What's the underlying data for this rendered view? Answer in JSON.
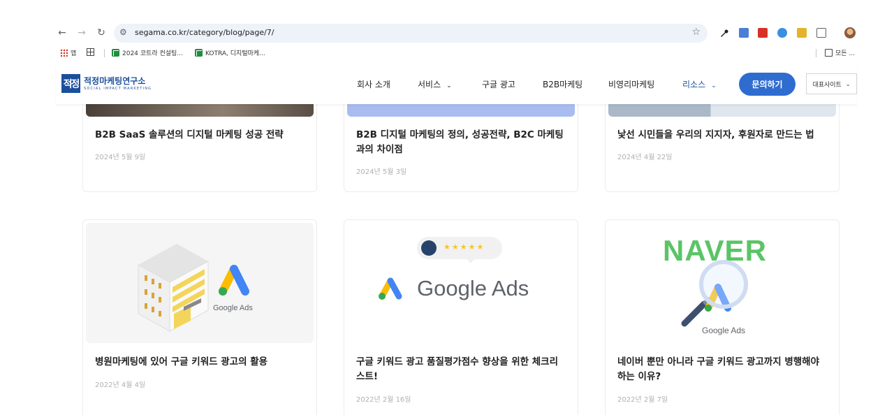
{
  "browser": {
    "url": "segama.co.kr/category/blog/page/7/",
    "bookmarks": [
      {
        "label": "앱"
      },
      {
        "label": "2024 코트라 컨설팅..."
      },
      {
        "label": "KOTRA, 디지털마케..."
      },
      {
        "label": "모든 ..."
      }
    ]
  },
  "site": {
    "logo_name": "적정마케팅연구소",
    "logo_sub": "SOCIAL IMPACT MARKETING",
    "logo_mark": "적정",
    "menu": [
      {
        "label": "회사 소개"
      },
      {
        "label": "서비스"
      },
      {
        "label": "구글 광고"
      },
      {
        "label": "B2B마케팅"
      },
      {
        "label": "비영리마케팅"
      },
      {
        "label": "리소스"
      }
    ],
    "cta_label": "문의하기",
    "site_select": "대표사이트"
  },
  "posts_top": [
    {
      "title_lines": [
        "B2B SaaS 솔루션의 디지털 마케팅 성공 전략"
      ],
      "date": "2024년 5월 9일"
    },
    {
      "title_lines": [
        "B2B 디지털 마케팅의 정의, 성공전략, B2C 마케팅",
        "과의 차이점"
      ],
      "date": "2024년 5월 3일"
    },
    {
      "title_lines": [
        "낯선 시민들을 우리의 지지자, 후원자로 만드는 법"
      ],
      "date": "2024년 4월 22일"
    }
  ],
  "posts_bottom": [
    {
      "title_lines": [
        "병원마케팅에 있어 구글 키워드 광고의 활용"
      ],
      "date": "2022년 4월 4일",
      "thumb_text": "Google Ads"
    },
    {
      "title_lines": [
        "구글 키워드 광고 품질평가점수 향상을 위한 체크리",
        "스트!"
      ],
      "date": "2022년 2월 16일",
      "thumb_text": "Google Ads",
      "stars": "★★★★★"
    },
    {
      "title_lines": [
        "네이버 뿐만 아니라 구글 키워드 광고까지 병행해야",
        "하는 이유?"
      ],
      "date": "2022년 2월 7일",
      "thumb_text": "Google Ads",
      "thumb_brand": "NAVER"
    }
  ],
  "colors": {
    "brand": "#1b4f9c",
    "cta": "#2f6cd0",
    "naver": "#5ac466"
  }
}
